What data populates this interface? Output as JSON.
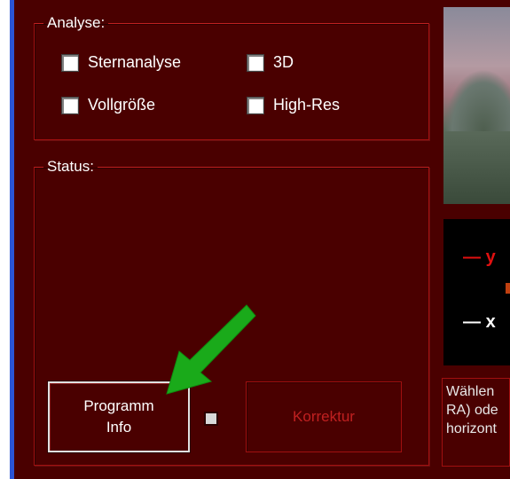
{
  "analyse": {
    "legend": "Analyse:",
    "options": [
      {
        "label": "Sternanalyse",
        "checked": false
      },
      {
        "label": "3D",
        "checked": false
      },
      {
        "label": "Vollgröße",
        "checked": false
      },
      {
        "label": "High-Res",
        "checked": false
      }
    ]
  },
  "status": {
    "legend": "Status:"
  },
  "buttons": {
    "info_line1": "Programm",
    "info_line2": "Info",
    "korrektur": "Korrektur"
  },
  "axes": {
    "y_label": "y",
    "x_label": "x"
  },
  "hint": {
    "text_lines": [
      "Wählen",
      "RA) ode",
      "horizont"
    ]
  },
  "colors": {
    "panel_bg": "#4a0000",
    "frame_red": "#a01010",
    "disabled_text": "#c02020",
    "annotation_arrow": "#1aaa1a"
  },
  "icons": {
    "annotation": "green-arrow-pointing-down-left"
  }
}
